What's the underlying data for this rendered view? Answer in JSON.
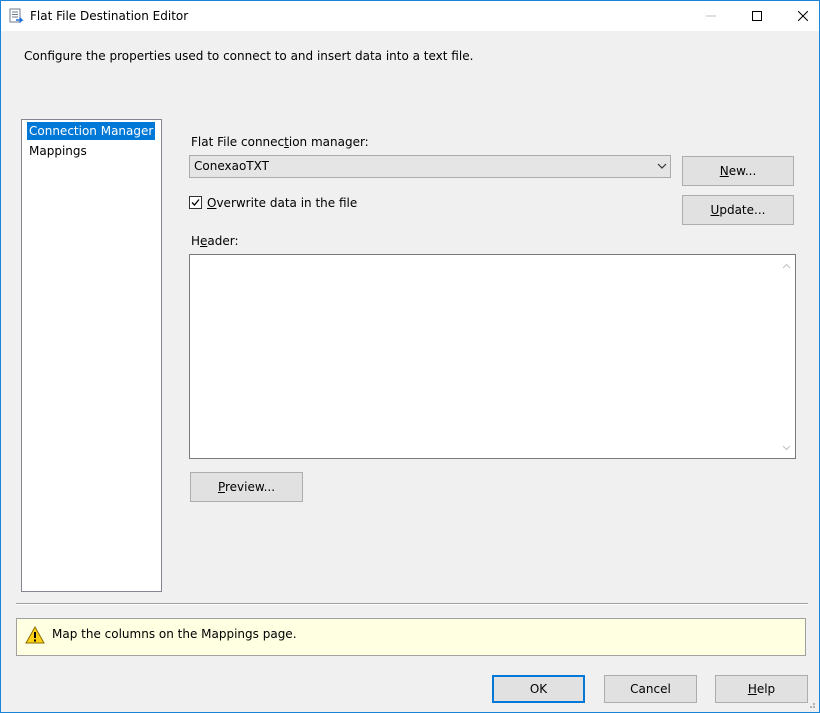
{
  "window": {
    "title": "Flat File Destination Editor",
    "icon": "flat-file-destination-icon"
  },
  "description": "Configure the properties used to connect to and insert data into a text file.",
  "nav": {
    "items": [
      {
        "label": "Connection Manager",
        "selected": true
      },
      {
        "label": "Mappings",
        "selected": false
      }
    ]
  },
  "connection": {
    "manager_label_pre": "Flat File connec",
    "manager_label_key": "t",
    "manager_label_post": "ion manager:",
    "selected_value": "ConexaoTXT",
    "new_button_key": "N",
    "new_button_rest": "ew...",
    "update_button_key": "U",
    "update_button_rest": "pdate...",
    "overwrite_key": "O",
    "overwrite_rest": "verwrite data in the file",
    "overwrite_checked": true,
    "header_label_pre": "H",
    "header_label_key": "e",
    "header_label_post": "ader:",
    "header_value": "",
    "preview_button_key": "P",
    "preview_button_rest": "review..."
  },
  "status": {
    "icon": "warning-icon",
    "message": "Map the columns on the Mappings page."
  },
  "footer": {
    "ok_label": "OK",
    "cancel_label": "Cancel",
    "help_key": "H",
    "help_rest": "elp"
  },
  "colors": {
    "selection": "#0078d7",
    "warning_background": "#ffffe1",
    "window_border": "#1883d7"
  }
}
